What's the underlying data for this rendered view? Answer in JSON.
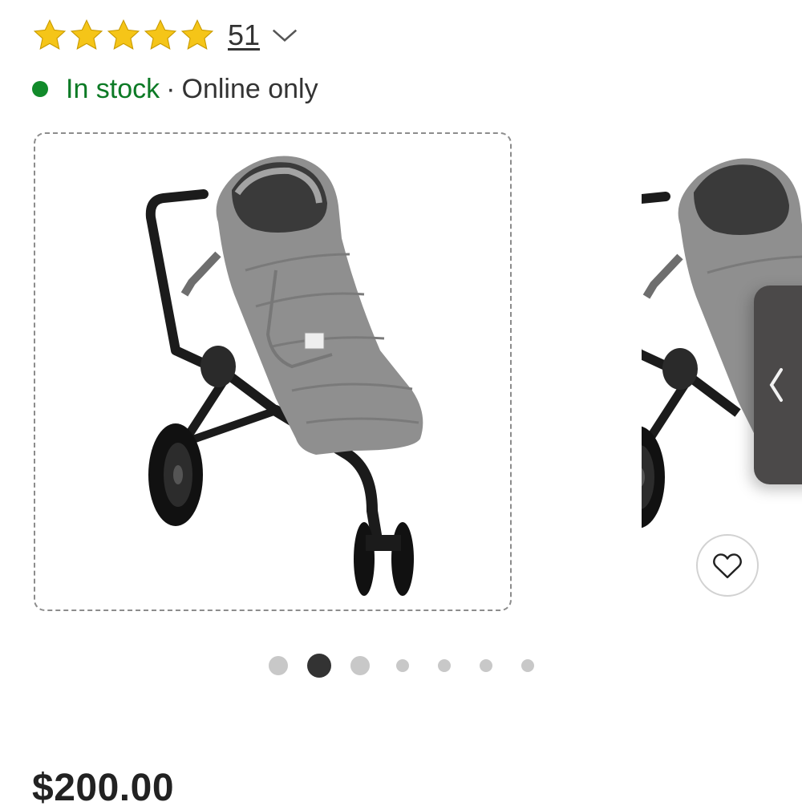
{
  "rating": {
    "stars": 5,
    "star_color": "#F5C518",
    "review_count": "51",
    "expand_icon": "chevron-down-icon"
  },
  "availability": {
    "status": "In stock",
    "separator": "·",
    "channel": "Online only",
    "status_color": "#0C7A25"
  },
  "gallery": {
    "pages": 7,
    "current_page": 2,
    "prev_icon": "chevron-left-icon",
    "favorite_icon": "heart-icon"
  },
  "product": {
    "price": "$200.00"
  }
}
